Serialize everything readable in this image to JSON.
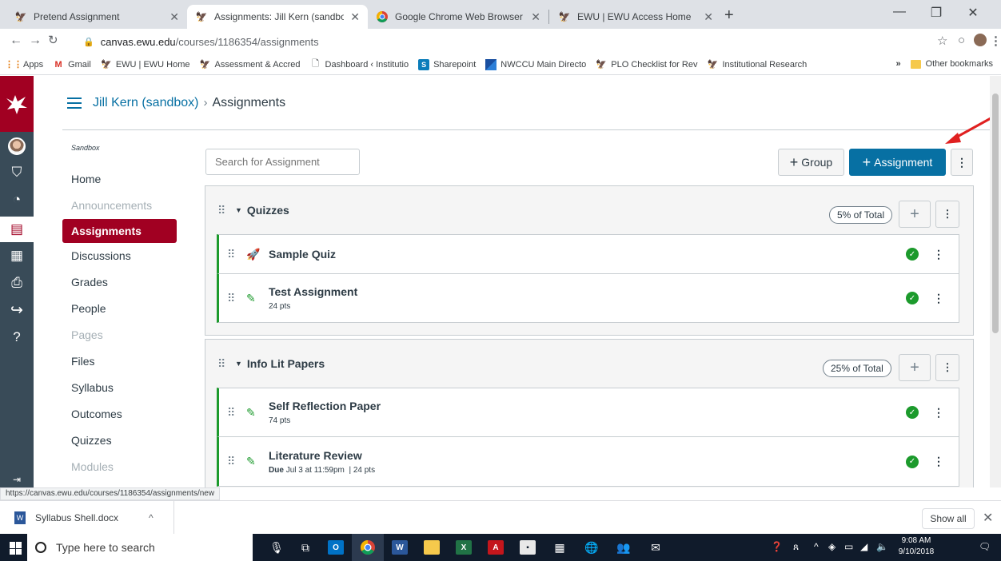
{
  "browser": {
    "tabs": [
      {
        "title": "Pretend Assignment",
        "favicon": "eagle-icon",
        "active": false
      },
      {
        "title": "Assignments: Jill Kern (sandbox)",
        "favicon": "eagle-icon",
        "active": true
      },
      {
        "title": "Google Chrome Web Browser",
        "favicon": "chrome-icon",
        "active": false
      },
      {
        "title": "EWU | EWU Access Home",
        "favicon": "eagle-icon",
        "active": false
      }
    ],
    "url_domain": "canvas.ewu.edu",
    "url_path": "/courses/1186354/assignments",
    "bookmarks": [
      {
        "label": "Apps"
      },
      {
        "label": "Gmail"
      },
      {
        "label": "EWU | EWU Home"
      },
      {
        "label": "Assessment & Accred"
      },
      {
        "label": "Dashboard ‹ Institutio"
      },
      {
        "label": "Sharepoint"
      },
      {
        "label": "NWCCU Main Directo"
      },
      {
        "label": "PLO Checklist for Rev"
      },
      {
        "label": "Institutional Research"
      }
    ],
    "bookmarks_overflow": "»",
    "other_bookmarks": "Other bookmarks",
    "status_url": "https://canvas.ewu.edu/courses/1186354/assignments/new"
  },
  "breadcrumb": {
    "course": "Jill Kern (sandbox)",
    "separator": "›",
    "page": "Assignments"
  },
  "course_nav": {
    "context": "Sandbox",
    "items": [
      {
        "label": "Home",
        "state": "normal"
      },
      {
        "label": "Announcements",
        "state": "disabled"
      },
      {
        "label": "Assignments",
        "state": "active"
      },
      {
        "label": "Discussions",
        "state": "normal"
      },
      {
        "label": "Grades",
        "state": "normal"
      },
      {
        "label": "People",
        "state": "normal"
      },
      {
        "label": "Pages",
        "state": "disabled"
      },
      {
        "label": "Files",
        "state": "normal"
      },
      {
        "label": "Syllabus",
        "state": "normal"
      },
      {
        "label": "Outcomes",
        "state": "normal"
      },
      {
        "label": "Quizzes",
        "state": "normal"
      },
      {
        "label": "Modules",
        "state": "disabled"
      }
    ]
  },
  "toolbar": {
    "search_placeholder": "Search for Assignment",
    "group_label": "Group",
    "assignment_label": "Assignment",
    "more_label": "⋮"
  },
  "groups": [
    {
      "name": "Quizzes",
      "weight": "5% of Total",
      "items": [
        {
          "title": "Sample Quiz",
          "icon": "quiz-rocket-icon",
          "meta": "",
          "due": "",
          "published": true
        },
        {
          "title": "Test Assignment",
          "icon": "assignment-icon",
          "meta": "24 pts",
          "due": "",
          "published": true
        }
      ]
    },
    {
      "name": "Info Lit Papers",
      "weight": "25% of Total",
      "items": [
        {
          "title": "Self Reflection Paper",
          "icon": "assignment-icon",
          "meta": "74 pts",
          "due": "",
          "published": true
        },
        {
          "title": "Literature Review",
          "icon": "assignment-icon",
          "meta": "| 24 pts",
          "due_label": "Due",
          "due": "Jul 3 at 11:59pm",
          "published": true
        }
      ]
    }
  ],
  "downloads": {
    "file": "Syllabus Shell.docx",
    "show_all": "Show all"
  },
  "taskbar": {
    "search_placeholder": "Type here to search",
    "time": "9:08 AM",
    "date": "9/10/2018"
  },
  "colors": {
    "canvas_brand": "#a10022",
    "global_nav": "#394b58",
    "link_blue": "#0770a3",
    "published_green": "#1c9a2c",
    "annotation_arrow": "#e02020"
  }
}
